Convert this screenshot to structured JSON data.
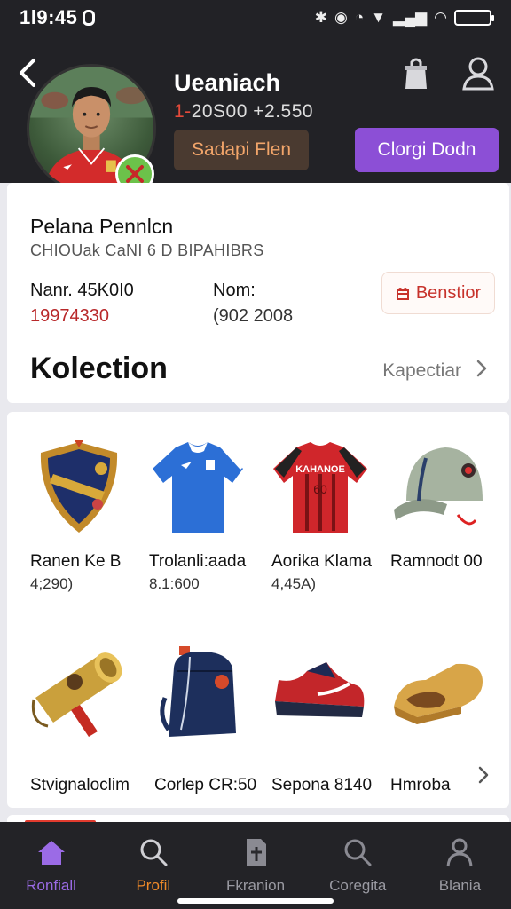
{
  "status_bar": {
    "time": "1l9:45",
    "icons": [
      "bluetooth-icon",
      "do-not-disturb-icon",
      "alarm-icon",
      "cellular-signal-icon",
      "wifi-icon",
      "battery-icon"
    ]
  },
  "header": {
    "name": "Ueaniach",
    "stats_prefix": "1-",
    "stats_value": "20S00 +2.550",
    "secondary_button": "Sadapi Flen",
    "primary_button": "Clorgi Dodn"
  },
  "info": {
    "title": "Pelana Pennlcn",
    "subtitle": "CHIOUak CaNI 6 D BIPAHIBRS",
    "stat_left_label": "Nanr. 45K0I0",
    "stat_left_value": "19974330",
    "stat_mid_label": "Nom:",
    "stat_mid_value": "(902 2008",
    "bonus_button": "Benstior",
    "collection_title": "Kolection",
    "collection_link": "Kapectiar"
  },
  "items": [
    {
      "name": "Ranen Ke  B",
      "price": "4;290)",
      "icon": "shield-icon"
    },
    {
      "name": "Trolanli:aada",
      "price": "8.1:600",
      "icon": "blue-jersey-icon"
    },
    {
      "name": "Aorika Klama",
      "price": "4,45A)",
      "icon": "red-jersey-icon"
    },
    {
      "name": "Ramnodt 00",
      "price": "",
      "icon": "cap-icon"
    },
    {
      "name": "Stvignaloclim",
      "price": "",
      "icon": "golden-horn-icon"
    },
    {
      "name": "Corlep CR:50",
      "price": "",
      "icon": "backpack-icon"
    },
    {
      "name": "Sepona 8140",
      "price": "",
      "icon": "sneaker-icon"
    },
    {
      "name": "Hmroba",
      "price": "",
      "icon": "golden-shoe-icon"
    }
  ],
  "jersey_text": "KAHANOE",
  "nav": [
    {
      "label": "Ronfiall",
      "icon": "home-icon"
    },
    {
      "label": "Profil",
      "icon": "search-icon"
    },
    {
      "label": "Fkranion",
      "icon": "document-icon"
    },
    {
      "label": "Coregita",
      "icon": "search-icon"
    },
    {
      "label": "Blania",
      "icon": "person-icon"
    }
  ],
  "colors": {
    "header_bg": "#222226",
    "primary_purple": "#8c4fd6",
    "accent_orange": "#f08a28",
    "accent_red": "#c7322b"
  }
}
